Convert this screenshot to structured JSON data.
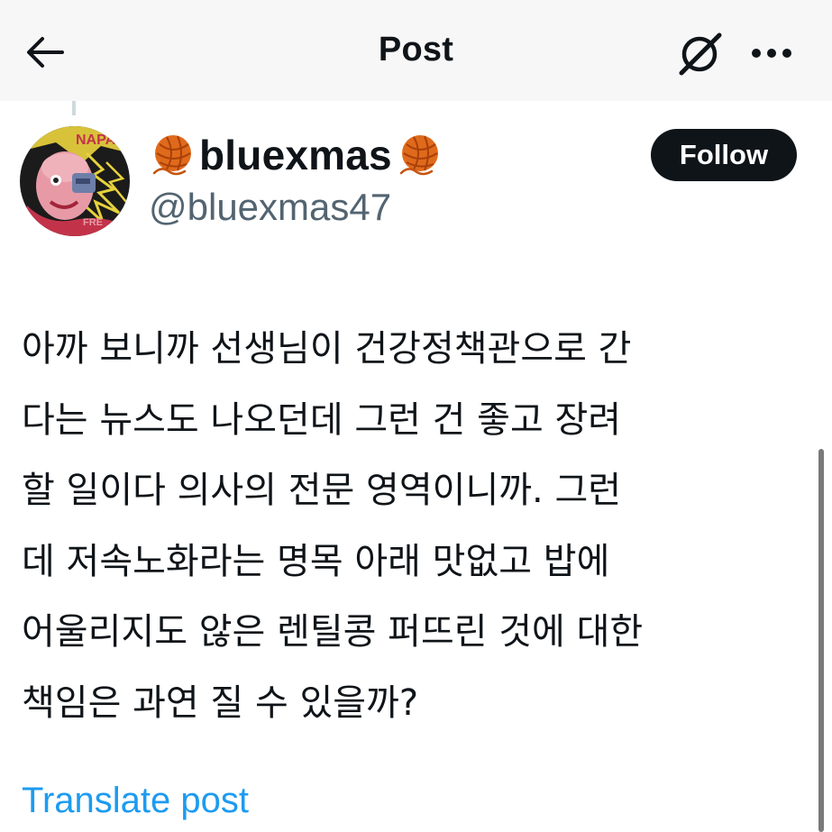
{
  "header": {
    "title": "Post",
    "back_icon": "back-arrow-icon",
    "grok_icon": "grok-icon",
    "more_icon": "more-horizontal-icon"
  },
  "author": {
    "display_name": "bluexmas",
    "name_emoji": "yarn-ball-emoji",
    "handle": "@bluexmas47",
    "avatar": "album-art-avatar"
  },
  "follow_button": {
    "label": "Follow"
  },
  "post": {
    "lines": [
      "아까 보니까 선생님이 건강정책관으로 간",
      "다는 뉴스도 나오던데 그런 건 좋고 장려",
      "할 일이다 의사의 전문 영역이니까. 그런",
      "데 저속노화라는 명목 아래 맛없고 밥에",
      "어울리지도 않은 렌틸콩 퍼뜨린 것에 대한",
      "책임은 과연 질 수 있을까?"
    ]
  },
  "translate_link": {
    "label": "Translate post"
  },
  "colors": {
    "text": "#0f1419",
    "secondary": "#536471",
    "link": "#1d9bf0",
    "follow_bg": "#0f1419",
    "header_bg": "#f7f7f8"
  }
}
